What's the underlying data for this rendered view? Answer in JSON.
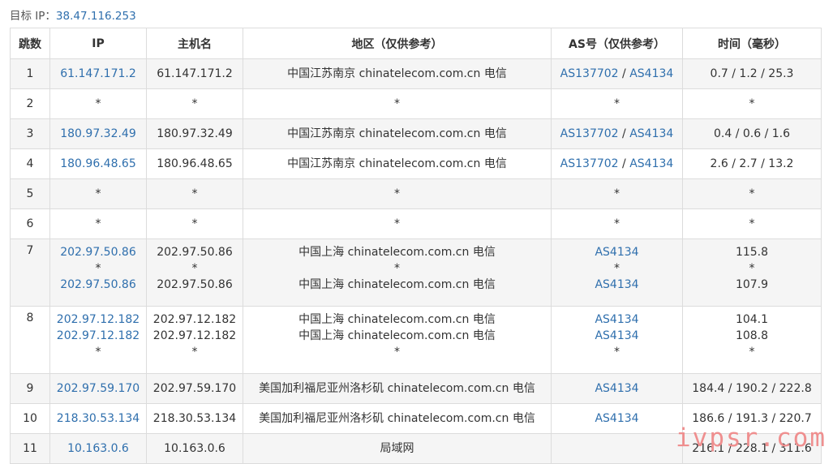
{
  "target": {
    "label": "目标 IP：",
    "ip": "38.47.116.253"
  },
  "headers": [
    "跳数",
    "IP",
    "主机名",
    "地区（仅供参考）",
    "AS号（仅供参考）",
    "时间（毫秒）"
  ],
  "rows": [
    {
      "hop": "1",
      "ip": [
        "61.147.171.2"
      ],
      "host": [
        "61.147.171.2"
      ],
      "region": [
        "中国江苏南京 chinatelecom.com.cn 电信"
      ],
      "as": [
        [
          "AS137702",
          "AS4134"
        ]
      ],
      "time": [
        "0.7 / 1.2 / 25.3"
      ]
    },
    {
      "hop": "2",
      "ip": [
        "*"
      ],
      "host": [
        "*"
      ],
      "region": [
        "*"
      ],
      "as": [
        [
          "*"
        ]
      ],
      "time": [
        "*"
      ]
    },
    {
      "hop": "3",
      "ip": [
        "180.97.32.49"
      ],
      "host": [
        "180.97.32.49"
      ],
      "region": [
        "中国江苏南京 chinatelecom.com.cn 电信"
      ],
      "as": [
        [
          "AS137702",
          "AS4134"
        ]
      ],
      "time": [
        "0.4 / 0.6 / 1.6"
      ]
    },
    {
      "hop": "4",
      "ip": [
        "180.96.48.65"
      ],
      "host": [
        "180.96.48.65"
      ],
      "region": [
        "中国江苏南京 chinatelecom.com.cn 电信"
      ],
      "as": [
        [
          "AS137702",
          "AS4134"
        ]
      ],
      "time": [
        "2.6 / 2.7 / 13.2"
      ]
    },
    {
      "hop": "5",
      "ip": [
        "*"
      ],
      "host": [
        "*"
      ],
      "region": [
        "*"
      ],
      "as": [
        [
          "*"
        ]
      ],
      "time": [
        "*"
      ]
    },
    {
      "hop": "6",
      "ip": [
        "*"
      ],
      "host": [
        "*"
      ],
      "region": [
        "*"
      ],
      "as": [
        [
          "*"
        ]
      ],
      "time": [
        "*"
      ]
    },
    {
      "hop": "7",
      "ip": [
        "202.97.50.86",
        "*",
        "202.97.50.86"
      ],
      "host": [
        "202.97.50.86",
        "*",
        "202.97.50.86"
      ],
      "region": [
        "中国上海 chinatelecom.com.cn 电信",
        "*",
        "中国上海 chinatelecom.com.cn 电信"
      ],
      "as": [
        [
          "AS4134"
        ],
        [
          "*"
        ],
        [
          "AS4134"
        ]
      ],
      "time": [
        "115.8",
        "*",
        "107.9"
      ]
    },
    {
      "hop": "8",
      "ip": [
        "202.97.12.182",
        "202.97.12.182",
        "*"
      ],
      "host": [
        "202.97.12.182",
        "202.97.12.182",
        "*"
      ],
      "region": [
        "中国上海 chinatelecom.com.cn 电信",
        "中国上海 chinatelecom.com.cn 电信",
        "*"
      ],
      "as": [
        [
          "AS4134"
        ],
        [
          "AS4134"
        ],
        [
          "*"
        ]
      ],
      "time": [
        "104.1",
        "108.8",
        "*"
      ]
    },
    {
      "hop": "9",
      "ip": [
        "202.97.59.170"
      ],
      "host": [
        "202.97.59.170"
      ],
      "region": [
        "美国加利福尼亚州洛杉矶 chinatelecom.com.cn 电信"
      ],
      "as": [
        [
          "AS4134"
        ]
      ],
      "time": [
        "184.4 / 190.2 / 222.8"
      ]
    },
    {
      "hop": "10",
      "ip": [
        "218.30.53.134"
      ],
      "host": [
        "218.30.53.134"
      ],
      "region": [
        "美国加利福尼亚州洛杉矶 chinatelecom.com.cn 电信"
      ],
      "as": [
        [
          "AS4134"
        ]
      ],
      "time": [
        "186.6 / 191.3 / 220.7"
      ]
    },
    {
      "hop": "11",
      "ip": [
        "10.163.0.6"
      ],
      "host": [
        "10.163.0.6"
      ],
      "region": [
        "局域网"
      ],
      "as": [
        [
          ""
        ]
      ],
      "time": [
        "216.1 / 228.1 / 311.6"
      ]
    }
  ],
  "watermark": "ivpsr.com"
}
